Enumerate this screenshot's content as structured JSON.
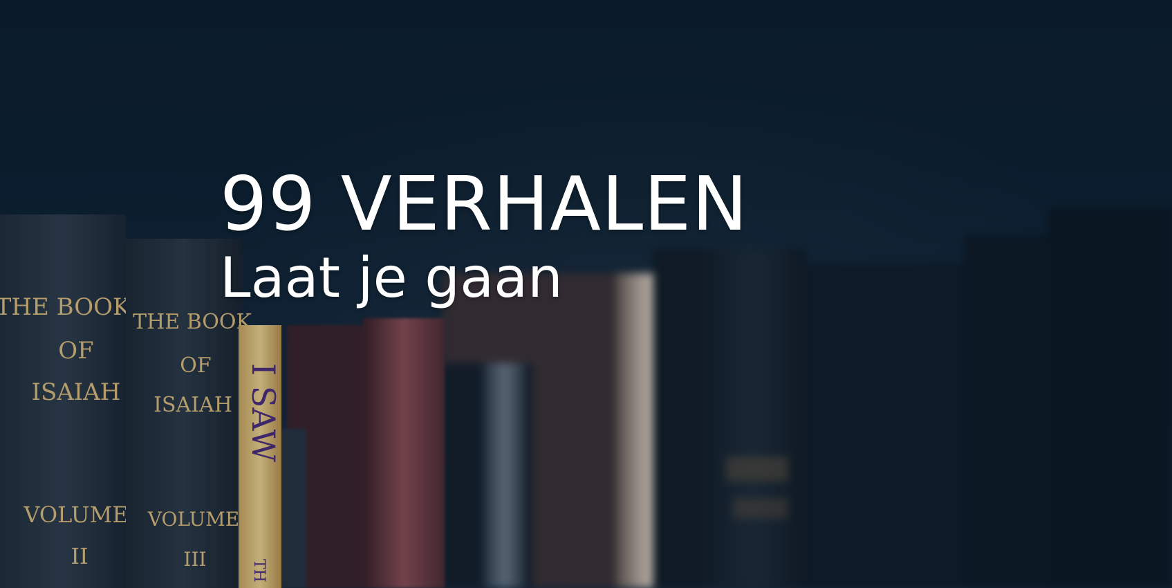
{
  "hero": {
    "title": "99 VERHALEN",
    "subtitle": "Laat je gaan",
    "background": {
      "book1": {
        "title_lines": [
          "THE BOOK",
          "OF",
          "ISAIAH"
        ],
        "volume_lines": [
          "VOLUME",
          "II"
        ]
      },
      "book2": {
        "title_lines": [
          "THE BOOK",
          "OF",
          "ISAIAH"
        ],
        "volume_lines": [
          "VOLUME",
          "III"
        ]
      },
      "book3": {
        "spine_text": "I SAW",
        "spine_small": "TH"
      }
    },
    "colors": {
      "background": "#0b1c2c",
      "text": "#ffffff",
      "spine_gold": "#d9b97a",
      "spine_yellow": "#e9c97d",
      "spine_purple": "#4a2a78"
    }
  }
}
